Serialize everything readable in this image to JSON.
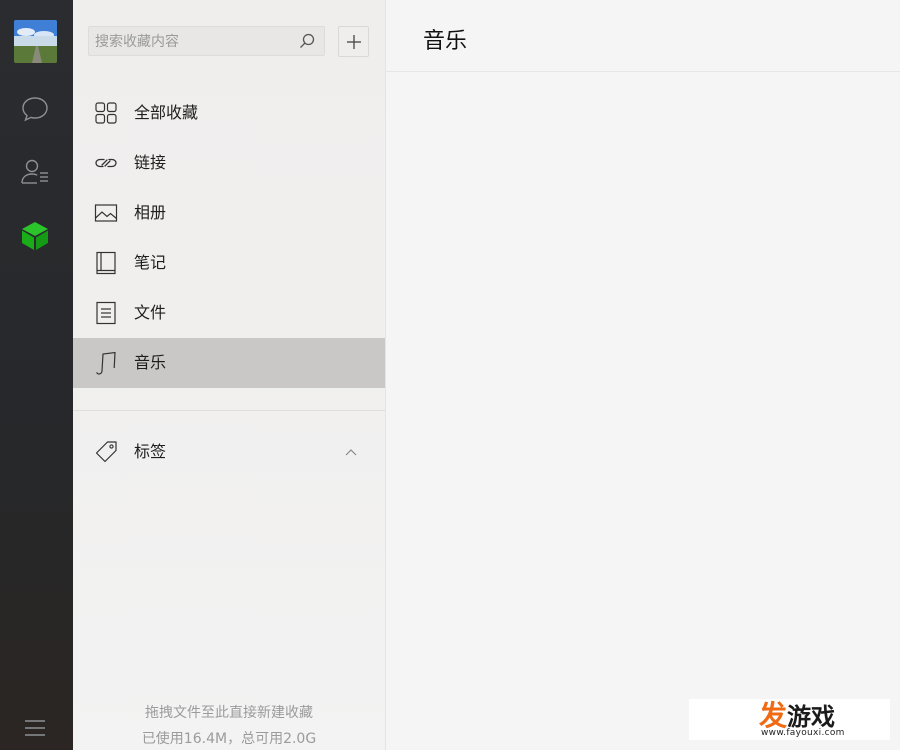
{
  "rail": {
    "items": [
      {
        "name": "chat-icon"
      },
      {
        "name": "contacts-icon"
      },
      {
        "name": "favorites-icon"
      }
    ],
    "accent": "#1aad19",
    "menu_icon": "hamburger-menu-icon"
  },
  "search": {
    "placeholder": "搜索收藏内容",
    "value": ""
  },
  "add_button": {
    "icon": "plus-icon"
  },
  "menu": {
    "items": [
      {
        "label": "全部收藏",
        "icon": "grid-icon",
        "active": false
      },
      {
        "label": "链接",
        "icon": "link-icon",
        "active": false
      },
      {
        "label": "相册",
        "icon": "image-icon",
        "active": false
      },
      {
        "label": "笔记",
        "icon": "notebook-icon",
        "active": false
      },
      {
        "label": "文件",
        "icon": "file-icon",
        "active": false
      },
      {
        "label": "音乐",
        "icon": "music-icon",
        "active": true
      }
    ]
  },
  "tags": {
    "label": "标签",
    "icon": "tag-icon",
    "expanded": true
  },
  "footer": {
    "hint": "拖拽文件至此直接新建收藏",
    "storage": "已使用16.4M，总可用2.0G"
  },
  "content": {
    "title": "音乐"
  },
  "watermark": {
    "first_char": "发",
    "rest": "游戏",
    "url": "www.fayouxi.com"
  }
}
